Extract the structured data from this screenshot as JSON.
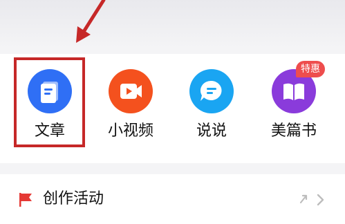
{
  "shortcuts": {
    "items": [
      {
        "label": "文章",
        "icon": "article-icon",
        "color": "#2f6ff5"
      },
      {
        "label": "小视频",
        "icon": "video-icon",
        "color": "#f4511e"
      },
      {
        "label": "说说",
        "icon": "chat-bubble-icon",
        "color": "#1aa5f2"
      },
      {
        "label": "美篇书",
        "icon": "book-icon",
        "color": "#8a3bdb",
        "badge": "特惠"
      }
    ]
  },
  "activity_row": {
    "label": "创作活动",
    "icon": "red-flag-icon"
  },
  "colors": {
    "annotation_red": "#c62828",
    "badge_red": "#ee4d4d"
  }
}
